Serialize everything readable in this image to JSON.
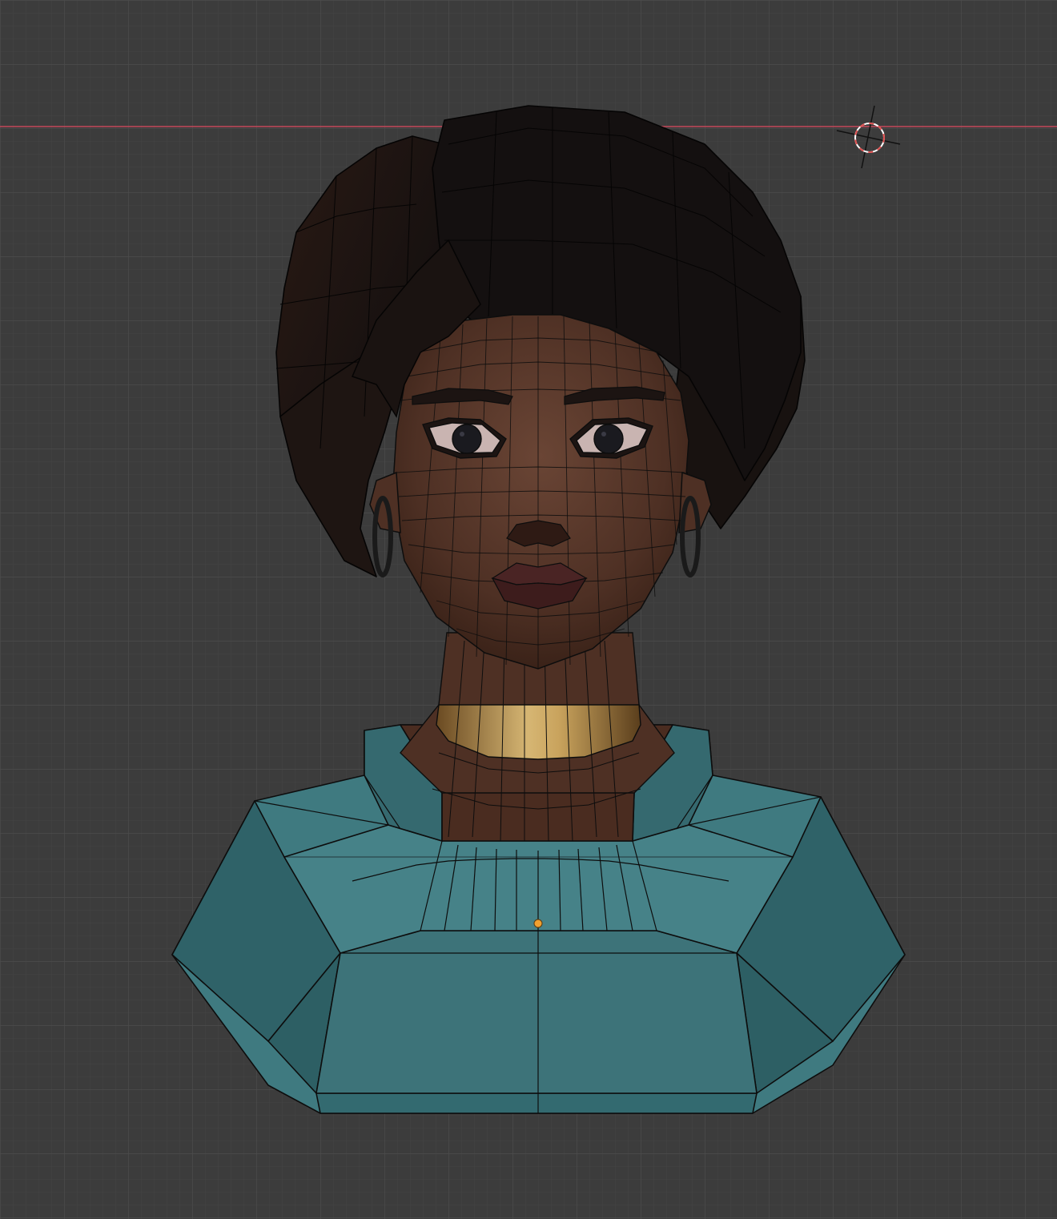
{
  "viewport": {
    "name": "3d-viewport",
    "background": "#3c3c3c",
    "grid_minor_color": "#444444",
    "grid_major_color": "#4d4d4d",
    "x_axis_color": "#c4475a"
  },
  "scene": {
    "object": "character-bust",
    "shading": "solid-with-wireframe",
    "colors": {
      "hair": "#1c1512",
      "hair_shadow": "#0e0a08",
      "skin": "#5b3a2c",
      "skin_shadow": "#3a2218",
      "shirt": "#3f7a80",
      "shirt_dark": "#2f6268",
      "choker": "#b8944e",
      "lips": "#4a2424",
      "eye_white": "#c9b4b1",
      "pupil": "#1a1a1f",
      "wire": "#0d0d0d",
      "origin_dot": "#f0a030",
      "cursor_red": "#e05050"
    }
  }
}
